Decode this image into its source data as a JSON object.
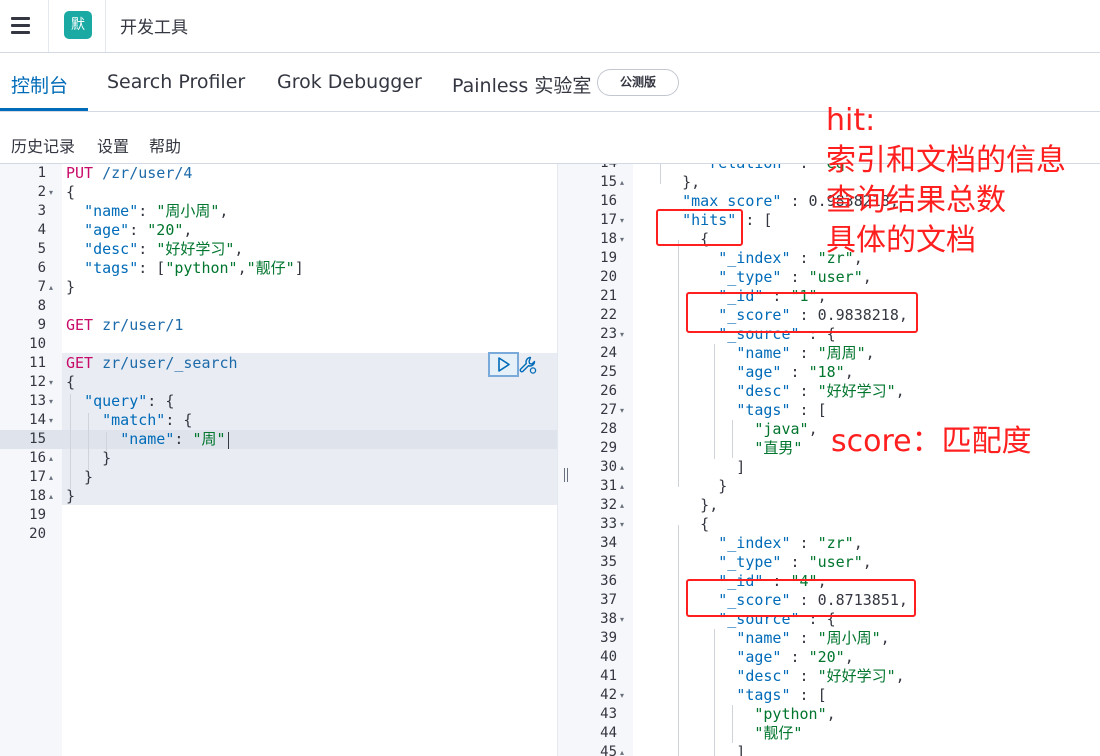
{
  "app": {
    "logo_text": "默",
    "title": "开发工具"
  },
  "tabs": [
    {
      "label": "控制台",
      "active": true
    },
    {
      "label": "Search Profiler"
    },
    {
      "label": "Grok Debugger"
    },
    {
      "label": "Painless 实验室"
    }
  ],
  "beta_badge": "公测版",
  "subnav": [
    "历史记录",
    "设置",
    "帮助"
  ],
  "colors": {
    "accent": "#006bb8",
    "annotation": "#ff1f1f",
    "logo_bg": "#1ba9a3"
  },
  "icons": {
    "menu": "hamburger-icon",
    "run": "play-icon",
    "settings": "wrench-icon",
    "resizer": "drag-handle-icon"
  },
  "request_editor": {
    "lines": [
      {
        "n": "1",
        "fold": "",
        "segs": [
          [
            "kw",
            "PUT"
          ],
          [
            "pun",
            " "
          ],
          [
            "url",
            "/zr/user/4"
          ]
        ]
      },
      {
        "n": "2",
        "fold": "▾",
        "segs": [
          [
            "pun",
            "{"
          ]
        ]
      },
      {
        "n": "3",
        "fold": "",
        "segs": [
          [
            "pun",
            "  "
          ],
          [
            "key",
            "\"name\""
          ],
          [
            "pun",
            ": "
          ],
          [
            "str",
            "\"周小周\""
          ],
          [
            "pun",
            ","
          ]
        ]
      },
      {
        "n": "4",
        "fold": "",
        "segs": [
          [
            "pun",
            "  "
          ],
          [
            "key",
            "\"age\""
          ],
          [
            "pun",
            ": "
          ],
          [
            "str",
            "\"20\""
          ],
          [
            "pun",
            ","
          ]
        ]
      },
      {
        "n": "5",
        "fold": "",
        "segs": [
          [
            "pun",
            "  "
          ],
          [
            "key",
            "\"desc\""
          ],
          [
            "pun",
            ": "
          ],
          [
            "str",
            "\"好好学习\""
          ],
          [
            "pun",
            ","
          ]
        ]
      },
      {
        "n": "6",
        "fold": "",
        "segs": [
          [
            "pun",
            "  "
          ],
          [
            "key",
            "\"tags\""
          ],
          [
            "pun",
            ": ["
          ],
          [
            "str",
            "\"python\""
          ],
          [
            "pun",
            ","
          ],
          [
            "str",
            "\"靓仔\""
          ],
          [
            "pun",
            "]"
          ]
        ]
      },
      {
        "n": "7",
        "fold": "▴",
        "segs": [
          [
            "pun",
            "}"
          ]
        ]
      },
      {
        "n": "8",
        "fold": "",
        "segs": []
      },
      {
        "n": "9",
        "fold": "",
        "segs": [
          [
            "kw",
            "GET"
          ],
          [
            "pun",
            " "
          ],
          [
            "url",
            "zr/user/1"
          ]
        ]
      },
      {
        "n": "10",
        "fold": "",
        "segs": []
      },
      {
        "n": "11",
        "fold": "",
        "segs": [
          [
            "kw",
            "GET"
          ],
          [
            "pun",
            " "
          ],
          [
            "url",
            "zr/user/_search"
          ]
        ]
      },
      {
        "n": "12",
        "fold": "▾",
        "segs": [
          [
            "pun",
            "{"
          ]
        ]
      },
      {
        "n": "13",
        "fold": "▾",
        "segs": [
          [
            "pun",
            "  "
          ],
          [
            "key",
            "\"query\""
          ],
          [
            "pun",
            ": {"
          ]
        ]
      },
      {
        "n": "14",
        "fold": "▾",
        "segs": [
          [
            "pun",
            "    "
          ],
          [
            "key",
            "\"match\""
          ],
          [
            "pun",
            ": {"
          ]
        ]
      },
      {
        "n": "15",
        "fold": "",
        "segs": [
          [
            "pun",
            "      "
          ],
          [
            "key",
            "\"name\""
          ],
          [
            "pun",
            ": "
          ],
          [
            "str",
            "\"周\""
          ]
        ]
      },
      {
        "n": "16",
        "fold": "▴",
        "segs": [
          [
            "pun",
            "    }"
          ]
        ]
      },
      {
        "n": "17",
        "fold": "▴",
        "segs": [
          [
            "pun",
            "  }"
          ]
        ]
      },
      {
        "n": "18",
        "fold": "▴",
        "segs": [
          [
            "pun",
            "}"
          ]
        ]
      },
      {
        "n": "19",
        "fold": "",
        "segs": []
      },
      {
        "n": "20",
        "fold": "",
        "segs": []
      }
    ]
  },
  "response_editor": {
    "lines": [
      {
        "n": "14",
        "fold": "",
        "segs": [
          [
            "pun",
            "      "
          ],
          [
            "key",
            "\"relation\""
          ],
          [
            "pun",
            " : "
          ],
          [
            "str",
            "\"eq\""
          ]
        ]
      },
      {
        "n": "15",
        "fold": "▴",
        "segs": [
          [
            "pun",
            "    },"
          ]
        ]
      },
      {
        "n": "16",
        "fold": "",
        "segs": [
          [
            "pun",
            "    "
          ],
          [
            "key",
            "\"max_score\""
          ],
          [
            "pun",
            " : 0.9838218,"
          ]
        ]
      },
      {
        "n": "17",
        "fold": "▾",
        "segs": [
          [
            "pun",
            "    "
          ],
          [
            "key",
            "\"hits\""
          ],
          [
            "pun",
            " : ["
          ]
        ]
      },
      {
        "n": "18",
        "fold": "▾",
        "segs": [
          [
            "pun",
            "      {"
          ]
        ]
      },
      {
        "n": "19",
        "fold": "",
        "segs": [
          [
            "pun",
            "        "
          ],
          [
            "key",
            "\"_index\""
          ],
          [
            "pun",
            " : "
          ],
          [
            "str",
            "\"zr\""
          ],
          [
            "pun",
            ","
          ]
        ]
      },
      {
        "n": "20",
        "fold": "",
        "segs": [
          [
            "pun",
            "        "
          ],
          [
            "key",
            "\"_type\""
          ],
          [
            "pun",
            " : "
          ],
          [
            "str",
            "\"user\""
          ],
          [
            "pun",
            ","
          ]
        ]
      },
      {
        "n": "21",
        "fold": "",
        "segs": [
          [
            "pun",
            "        "
          ],
          [
            "key",
            "\"_id\""
          ],
          [
            "pun",
            " : "
          ],
          [
            "str",
            "\"1\""
          ],
          [
            "pun",
            ","
          ]
        ]
      },
      {
        "n": "22",
        "fold": "",
        "segs": [
          [
            "pun",
            "        "
          ],
          [
            "key",
            "\"_score\""
          ],
          [
            "pun",
            " : 0.9838218,"
          ]
        ]
      },
      {
        "n": "23",
        "fold": "▾",
        "segs": [
          [
            "pun",
            "        "
          ],
          [
            "key",
            "\"_source\""
          ],
          [
            "pun",
            " : {"
          ]
        ]
      },
      {
        "n": "24",
        "fold": "",
        "segs": [
          [
            "pun",
            "          "
          ],
          [
            "key",
            "\"name\""
          ],
          [
            "pun",
            " : "
          ],
          [
            "str",
            "\"周周\""
          ],
          [
            "pun",
            ","
          ]
        ]
      },
      {
        "n": "25",
        "fold": "",
        "segs": [
          [
            "pun",
            "          "
          ],
          [
            "key",
            "\"age\""
          ],
          [
            "pun",
            " : "
          ],
          [
            "str",
            "\"18\""
          ],
          [
            "pun",
            ","
          ]
        ]
      },
      {
        "n": "26",
        "fold": "",
        "segs": [
          [
            "pun",
            "          "
          ],
          [
            "key",
            "\"desc\""
          ],
          [
            "pun",
            " : "
          ],
          [
            "str",
            "\"好好学习\""
          ],
          [
            "pun",
            ","
          ]
        ]
      },
      {
        "n": "27",
        "fold": "▾",
        "segs": [
          [
            "pun",
            "          "
          ],
          [
            "key",
            "\"tags\""
          ],
          [
            "pun",
            " : ["
          ]
        ]
      },
      {
        "n": "28",
        "fold": "",
        "segs": [
          [
            "pun",
            "            "
          ],
          [
            "str",
            "\"java\""
          ],
          [
            "pun",
            ","
          ]
        ]
      },
      {
        "n": "29",
        "fold": "",
        "segs": [
          [
            "pun",
            "            "
          ],
          [
            "str",
            "\"直男\""
          ]
        ]
      },
      {
        "n": "30",
        "fold": "▴",
        "segs": [
          [
            "pun",
            "          ]"
          ]
        ]
      },
      {
        "n": "31",
        "fold": "▴",
        "segs": [
          [
            "pun",
            "        }"
          ]
        ]
      },
      {
        "n": "32",
        "fold": "▴",
        "segs": [
          [
            "pun",
            "      },"
          ]
        ]
      },
      {
        "n": "33",
        "fold": "▾",
        "segs": [
          [
            "pun",
            "      {"
          ]
        ]
      },
      {
        "n": "34",
        "fold": "",
        "segs": [
          [
            "pun",
            "        "
          ],
          [
            "key",
            "\"_index\""
          ],
          [
            "pun",
            " : "
          ],
          [
            "str",
            "\"zr\""
          ],
          [
            "pun",
            ","
          ]
        ]
      },
      {
        "n": "35",
        "fold": "",
        "segs": [
          [
            "pun",
            "        "
          ],
          [
            "key",
            "\"_type\""
          ],
          [
            "pun",
            " : "
          ],
          [
            "str",
            "\"user\""
          ],
          [
            "pun",
            ","
          ]
        ]
      },
      {
        "n": "36",
        "fold": "",
        "segs": [
          [
            "pun",
            "        "
          ],
          [
            "key",
            "\"_id\""
          ],
          [
            "pun",
            " : "
          ],
          [
            "str",
            "\"4\""
          ],
          [
            "pun",
            ","
          ]
        ]
      },
      {
        "n": "37",
        "fold": "",
        "segs": [
          [
            "pun",
            "        "
          ],
          [
            "key",
            "\"_score\""
          ],
          [
            "pun",
            " : 0.8713851,"
          ]
        ]
      },
      {
        "n": "38",
        "fold": "▾",
        "segs": [
          [
            "pun",
            "        "
          ],
          [
            "key",
            "\"_source\""
          ],
          [
            "pun",
            " : {"
          ]
        ]
      },
      {
        "n": "39",
        "fold": "",
        "segs": [
          [
            "pun",
            "          "
          ],
          [
            "key",
            "\"name\""
          ],
          [
            "pun",
            " : "
          ],
          [
            "str",
            "\"周小周\""
          ],
          [
            "pun",
            ","
          ]
        ]
      },
      {
        "n": "40",
        "fold": "",
        "segs": [
          [
            "pun",
            "          "
          ],
          [
            "key",
            "\"age\""
          ],
          [
            "pun",
            " : "
          ],
          [
            "str",
            "\"20\""
          ],
          [
            "pun",
            ","
          ]
        ]
      },
      {
        "n": "41",
        "fold": "",
        "segs": [
          [
            "pun",
            "          "
          ],
          [
            "key",
            "\"desc\""
          ],
          [
            "pun",
            " : "
          ],
          [
            "str",
            "\"好好学习\""
          ],
          [
            "pun",
            ","
          ]
        ]
      },
      {
        "n": "42",
        "fold": "▾",
        "segs": [
          [
            "pun",
            "          "
          ],
          [
            "key",
            "\"tags\""
          ],
          [
            "pun",
            " : ["
          ]
        ]
      },
      {
        "n": "43",
        "fold": "",
        "segs": [
          [
            "pun",
            "            "
          ],
          [
            "str",
            "\"python\""
          ],
          [
            "pun",
            ","
          ]
        ]
      },
      {
        "n": "44",
        "fold": "",
        "segs": [
          [
            "pun",
            "            "
          ],
          [
            "str",
            "\"靓仔\""
          ]
        ]
      },
      {
        "n": "45",
        "fold": "▴",
        "segs": [
          [
            "pun",
            "          ]"
          ]
        ]
      }
    ]
  },
  "annotations": {
    "hit_title": "hit:",
    "hit_lines": [
      "索引和文档的信息",
      "查询结果总数",
      "具体的文档"
    ],
    "score_note": "score：匹配度"
  }
}
